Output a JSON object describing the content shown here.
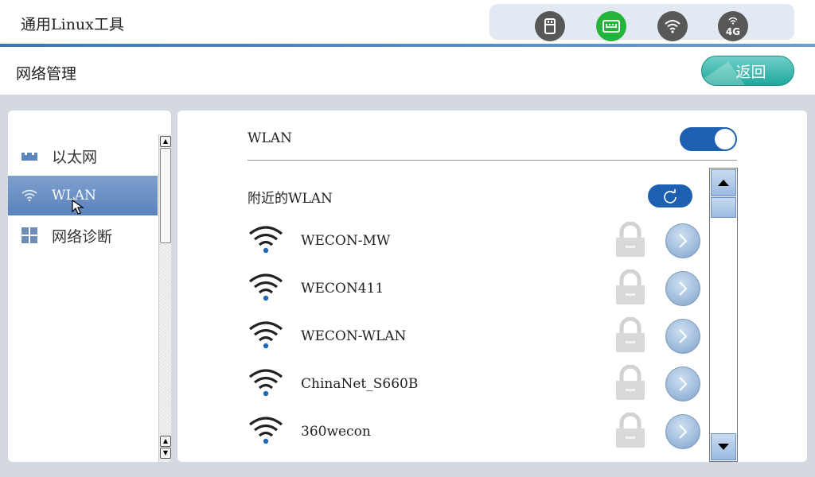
{
  "titlebar": {
    "app_title": "通用Linux工具",
    "status_icons": [
      "usb-icon",
      "ethernet-icon",
      "wifi-icon",
      "4g-icon"
    ],
    "active_status_icon": "ethernet-icon",
    "four_g_label": "4G"
  },
  "header": {
    "page_title": "网络管理",
    "back_label": "返回"
  },
  "sidebar": {
    "items": [
      {
        "label": "以太网",
        "icon": "ethernet-port-icon",
        "selected": false
      },
      {
        "label": "WLAN",
        "icon": "wifi-icon",
        "selected": true
      },
      {
        "label": "网络诊断",
        "icon": "grid-icon",
        "selected": false
      }
    ]
  },
  "main": {
    "wlan_label": "WLAN",
    "wlan_enabled": true,
    "nearby_label": "附近的WLAN",
    "networks": [
      {
        "ssid": "WECON-MW"
      },
      {
        "ssid": "WECON411"
      },
      {
        "ssid": "WECON-WLAN"
      },
      {
        "ssid": "ChinaNet_S660B"
      },
      {
        "ssid": "360wecon"
      }
    ]
  },
  "colors": {
    "accent_blue": "#1d5fb0",
    "active_green": "#22b53a",
    "back_button_teal": "#1fa89c",
    "selected_nav": "#6b8fc4"
  }
}
